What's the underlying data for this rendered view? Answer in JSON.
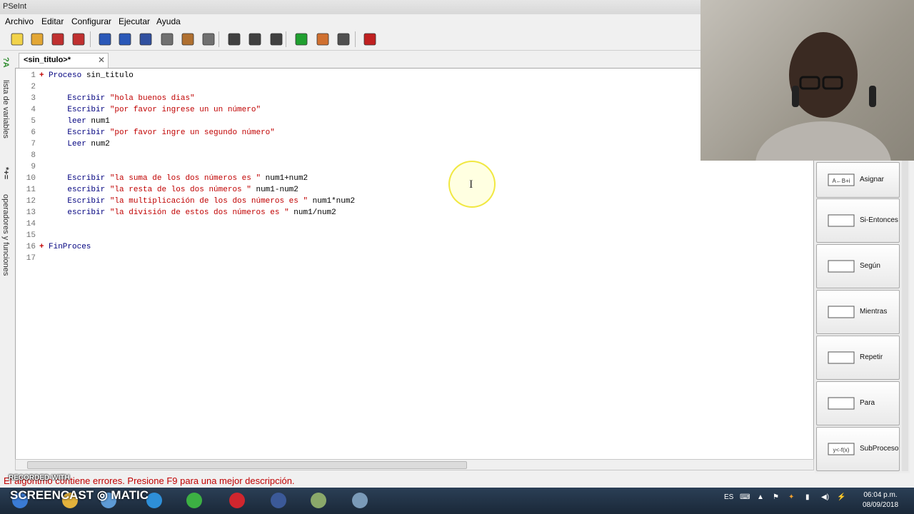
{
  "window": {
    "title": "PSeInt"
  },
  "menu": [
    "Archivo",
    "Editar",
    "Configurar",
    "Ejecutar",
    "Ayuda"
  ],
  "toolbar": [
    {
      "icon": "new-file-icon",
      "color": "#f2d34a"
    },
    {
      "icon": "open-folder-icon",
      "color": "#e3a735"
    },
    {
      "icon": "save-icon",
      "color": "#c03030"
    },
    {
      "icon": "save-as-icon",
      "color": "#c03030"
    },
    {
      "icon": "undo-icon",
      "color": "#2a58b8"
    },
    {
      "icon": "redo-icon",
      "color": "#2a58b8"
    },
    {
      "icon": "cut-icon",
      "color": "#3050a0"
    },
    {
      "icon": "copy-icon",
      "color": "#707070"
    },
    {
      "icon": "paste-icon",
      "color": "#b07030"
    },
    {
      "icon": "indent-icon",
      "color": "#707070"
    },
    {
      "icon": "find-icon",
      "color": "#404040"
    },
    {
      "icon": "find-prev-icon",
      "color": "#404040"
    },
    {
      "icon": "find-next-icon",
      "color": "#404040"
    },
    {
      "icon": "run-icon",
      "color": "#20a030"
    },
    {
      "icon": "step-icon",
      "color": "#d07030"
    },
    {
      "icon": "flowchart-icon",
      "color": "#505050"
    },
    {
      "icon": "help-icon",
      "color": "#c02020"
    }
  ],
  "tab": {
    "label": "<sin_titulo>*"
  },
  "side_tabs": {
    "variables": "lista de variables",
    "operators": "operadores y funciones"
  },
  "code": [
    {
      "n": "1",
      "fold": "+",
      "parts": [
        {
          "t": "Proceso ",
          "c": "kw"
        },
        {
          "t": "sin_titulo",
          "c": "var"
        }
      ]
    },
    {
      "n": "2",
      "parts": []
    },
    {
      "n": "3",
      "parts": [
        {
          "t": "    Escribir ",
          "c": "kw"
        },
        {
          "t": "\"hola buenos dias\"",
          "c": "str"
        }
      ]
    },
    {
      "n": "4",
      "parts": [
        {
          "t": "    Escribir ",
          "c": "kw"
        },
        {
          "t": "\"por favor ingrese un un número\"",
          "c": "str"
        }
      ]
    },
    {
      "n": "5",
      "parts": [
        {
          "t": "    leer ",
          "c": "kw"
        },
        {
          "t": "num1",
          "c": "var"
        }
      ]
    },
    {
      "n": "6",
      "parts": [
        {
          "t": "    Escribir ",
          "c": "kw"
        },
        {
          "t": "\"por favor ingre un segundo número\"",
          "c": "str"
        }
      ]
    },
    {
      "n": "7",
      "parts": [
        {
          "t": "    Leer ",
          "c": "kw"
        },
        {
          "t": "num2",
          "c": "var"
        }
      ]
    },
    {
      "n": "8",
      "parts": []
    },
    {
      "n": "9",
      "parts": []
    },
    {
      "n": "10",
      "parts": [
        {
          "t": "    Escribir ",
          "c": "kw"
        },
        {
          "t": "\"la suma de los dos números es \"",
          "c": "str"
        },
        {
          "t": " num1+num2",
          "c": "var"
        }
      ]
    },
    {
      "n": "11",
      "parts": [
        {
          "t": "    escribir ",
          "c": "kw"
        },
        {
          "t": "\"la resta de los dos números \"",
          "c": "str"
        },
        {
          "t": " num1-num2",
          "c": "var"
        }
      ]
    },
    {
      "n": "12",
      "parts": [
        {
          "t": "    Escribir ",
          "c": "kw"
        },
        {
          "t": "\"la multiplicación de los dos números es \"",
          "c": "str"
        },
        {
          "t": " num1*num2",
          "c": "var"
        }
      ]
    },
    {
      "n": "13",
      "parts": [
        {
          "t": "    escribir ",
          "c": "kw"
        },
        {
          "t": "\"la división de estos dos números es \"",
          "c": "str"
        },
        {
          "t": " num1/num2",
          "c": "var"
        }
      ]
    },
    {
      "n": "14",
      "parts": []
    },
    {
      "n": "15",
      "parts": []
    },
    {
      "n": "16",
      "fold": "+",
      "parts": [
        {
          "t": "FinProces",
          "c": "kw"
        }
      ]
    },
    {
      "n": "17",
      "parts": []
    }
  ],
  "panel_buttons": [
    {
      "label": "Asignar",
      "icon": "assign-icon",
      "glyph": "A←B+i"
    },
    {
      "label": "Si-Entonces",
      "icon": "if-then-icon",
      "glyph": ""
    },
    {
      "label": "Según",
      "icon": "switch-icon",
      "glyph": ""
    },
    {
      "label": "Mientras",
      "icon": "while-icon",
      "glyph": ""
    },
    {
      "label": "Repetir",
      "icon": "repeat-icon",
      "glyph": ""
    },
    {
      "label": "Para",
      "icon": "for-icon",
      "glyph": ""
    },
    {
      "label": "SubProceso",
      "icon": "subprocess-icon",
      "glyph": "y<-f(x)"
    }
  ],
  "status": {
    "text": "El algoritmo contiene errores. Presione F9 para una mejor descripción."
  },
  "overlay": {
    "recorded": "RECORDED WITH",
    "brand": "SCREENCAST ◎ MATIC"
  },
  "taskbar": {
    "apps": [
      {
        "name": "start-button",
        "color": "#3a7bd5"
      },
      {
        "name": "folder-app",
        "color": "#e3b23c"
      },
      {
        "name": "screencast-app",
        "color": "#5e9bd6"
      },
      {
        "name": "ie-app",
        "color": "#2e8fd8"
      },
      {
        "name": "chrome-app",
        "color": "#3cb043"
      },
      {
        "name": "opera-app",
        "color": "#d0262e"
      },
      {
        "name": "facebook-app",
        "color": "#3b5998"
      },
      {
        "name": "pseint-app",
        "color": "#8aa86a"
      },
      {
        "name": "obs-app",
        "color": "#7a9ab8"
      }
    ],
    "lang": "ES",
    "time": "06:04 p.m.",
    "date": "08/09/2018"
  }
}
